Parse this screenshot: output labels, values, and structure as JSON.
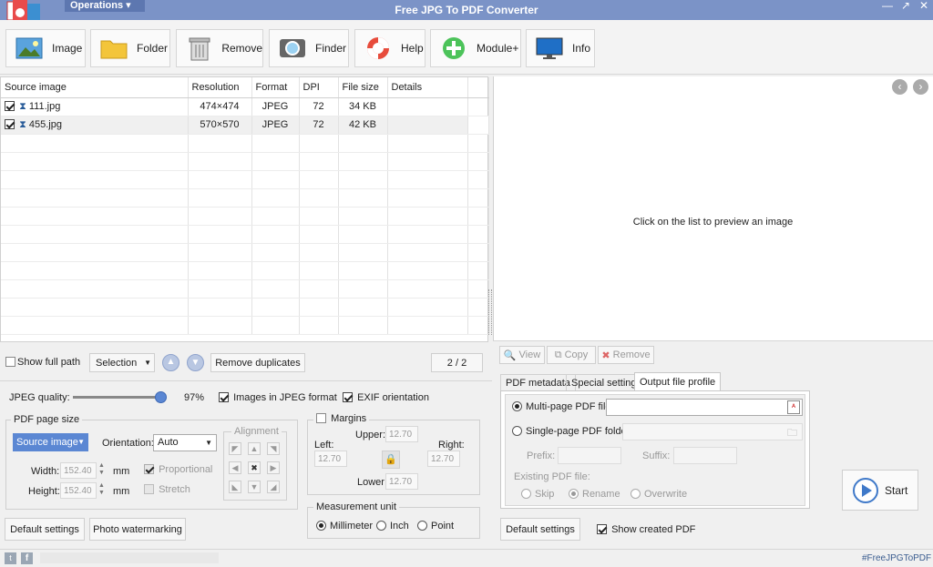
{
  "app": {
    "title": "Free JPG To PDF Converter",
    "operations_label": "Operations"
  },
  "toolbar": {
    "image": "Image",
    "folder": "Folder",
    "remove": "Remove",
    "finder": "Finder",
    "help": "Help",
    "module": "Module+",
    "info": "Info"
  },
  "table": {
    "headers": [
      "Source image",
      "Resolution",
      "Format",
      "DPI",
      "File size",
      "Details"
    ],
    "rows": [
      {
        "name": "111.jpg",
        "resolution": "474×474",
        "format": "JPEG",
        "dpi": "72",
        "size": "34 KB",
        "details": ""
      },
      {
        "name": "455.jpg",
        "resolution": "570×570",
        "format": "JPEG",
        "dpi": "72",
        "size": "42 KB",
        "details": ""
      }
    ]
  },
  "list_controls": {
    "show_full_path": "Show full path",
    "selection": "Selection",
    "remove_duplicates": "Remove duplicates",
    "count": "2 / 2"
  },
  "preview": {
    "hint": "Click on the list to preview an image",
    "view": "View",
    "copy": "Copy",
    "remove": "Remove"
  },
  "jpeg": {
    "quality_label": "JPEG quality:",
    "quality_value": "97%",
    "quality_fraction": 0.97,
    "images_in_jpeg": "Images in JPEG format",
    "exif": "EXIF orientation"
  },
  "page_size": {
    "group": "PDF page size",
    "source": "Source image",
    "orientation_label": "Orientation:",
    "orientation": "Auto",
    "width_label": "Width:",
    "width": "152.40",
    "height_label": "Height:",
    "height": "152.40",
    "unit": "mm",
    "proportional": "Proportional",
    "stretch": "Stretch",
    "alignment": "Alignment"
  },
  "margins": {
    "label": "Margins",
    "upper_label": "Upper:",
    "upper": "12.70",
    "left_label": "Left:",
    "left": "12.70",
    "right_label": "Right:",
    "right": "12.70",
    "lower_label": "Lower:",
    "lower": "12.70"
  },
  "measurement": {
    "group": "Measurement unit",
    "mm": "Millimeter",
    "inch": "Inch",
    "point": "Point"
  },
  "left_buttons": {
    "default": "Default settings",
    "watermark": "Photo watermarking"
  },
  "tabs": {
    "meta": "PDF metadata",
    "special": "Special settings",
    "profile": "Output file profile"
  },
  "output": {
    "multi": "Multi-page PDF file:",
    "single": "Single-page PDF folder:",
    "prefix": "Prefix:",
    "suffix": "Suffix:",
    "existing": "Existing PDF file:",
    "skip": "Skip",
    "rename": "Rename",
    "overwrite": "Overwrite"
  },
  "right_buttons": {
    "default": "Default settings",
    "show_created": "Show created PDF",
    "start": "Start"
  },
  "status": {
    "hashtag": "#FreeJPGToPDF"
  }
}
